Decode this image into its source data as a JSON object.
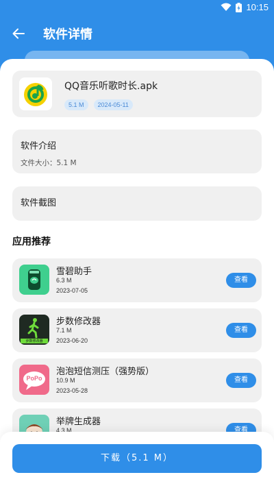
{
  "status": {
    "time": "10:15"
  },
  "header": {
    "title": "软件详情"
  },
  "app": {
    "name": "QQ音乐听歌时长.apk",
    "size_tag": "5.1 M",
    "date_tag": "2024-05-11",
    "logo_icon": "qq-music-icon"
  },
  "intro": {
    "title": "软件介绍",
    "file_size": "文件大小：5.1 M"
  },
  "screenshots": {
    "title": "软件截图"
  },
  "recommend": {
    "title": "应用推荐",
    "view_label": "查看",
    "items": [
      {
        "name": "雪碧助手",
        "size": "6.3 M",
        "date": "2023-07-05",
        "icon": "soda-can-icon"
      },
      {
        "name": "步数修改器",
        "size": "7.1 M",
        "date": "2023-06-20",
        "icon": "walking-person-icon",
        "icon_caption": "步数修改器"
      },
      {
        "name": "泡泡短信测压（强势版）",
        "size": "10.9 M",
        "date": "2023-05-28",
        "icon": "speech-bubble-icon",
        "icon_caption": "PoPo"
      },
      {
        "name": "举牌生成器",
        "size": "4.3 M",
        "date": "",
        "icon": "cartoon-character-icon"
      }
    ]
  },
  "footer": {
    "download_label": "下载（5.1 M）"
  },
  "colors": {
    "primary": "#2f8ee8",
    "card": "#f0f0f0",
    "tag_bg": "#d8e9fa"
  }
}
